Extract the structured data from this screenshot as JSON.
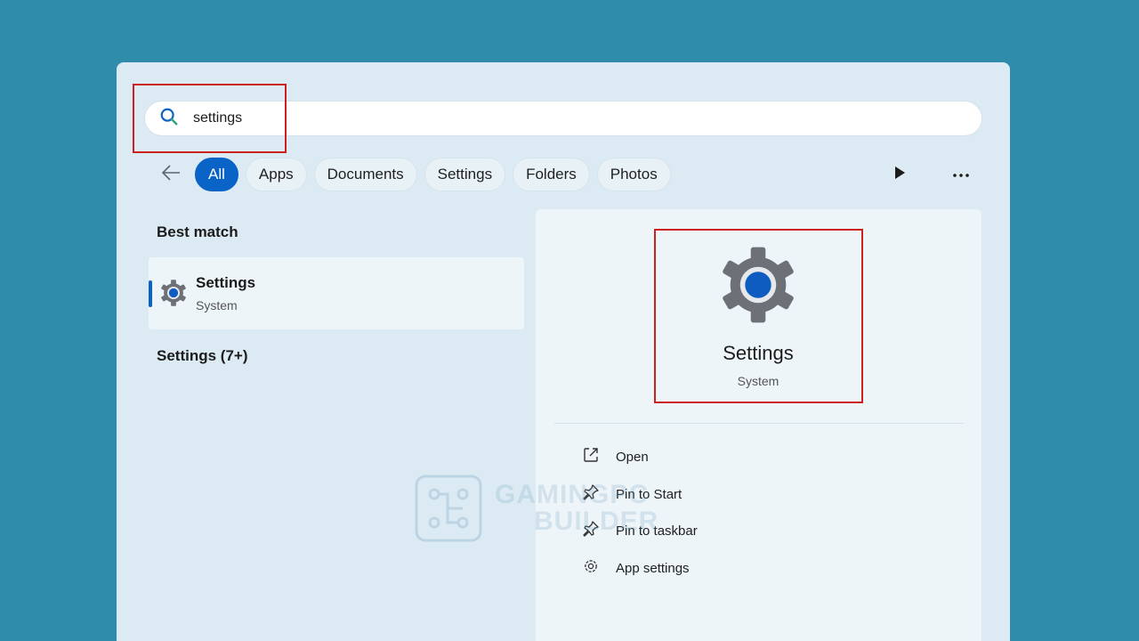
{
  "search": {
    "value": "settings"
  },
  "filters": [
    "All",
    "Apps",
    "Documents",
    "Settings",
    "Folders",
    "Photos"
  ],
  "left": {
    "best_match_heading": "Best match",
    "best_match": {
      "title": "Settings",
      "subtitle": "System"
    },
    "more_heading": "Settings (7+)"
  },
  "preview": {
    "title": "Settings",
    "subtitle": "System",
    "actions": [
      "Open",
      "Pin to Start",
      "Pin to taskbar",
      "App settings"
    ]
  },
  "watermark": {
    "line1": "GAMINGPC",
    "line2": "BUILDER"
  },
  "icons": {
    "search": "search-icon",
    "back": "back-arrow-icon",
    "play": "play-icon",
    "more": "more-icon",
    "settings": "settings-gear-icon",
    "open": "open-external-icon",
    "pin": "pin-icon",
    "app_settings": "gear-outline-icon"
  },
  "colors": {
    "accent": "#0a63c6",
    "highlight": "#cc1f1f",
    "background": "#2f8cab"
  }
}
